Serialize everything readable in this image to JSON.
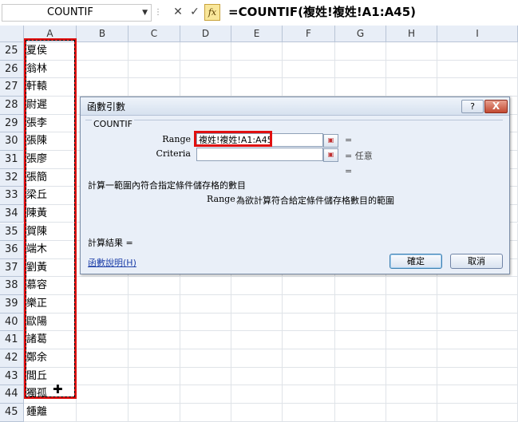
{
  "formula_bar": {
    "name_box": "COUNTIF",
    "formula": "=COUNTIF(複姓!複姓!A1:A45)",
    "fx_label": "fx"
  },
  "grid": {
    "columns": [
      "A",
      "B",
      "C",
      "D",
      "E",
      "F",
      "G",
      "H",
      "I"
    ],
    "rows": [
      {
        "num": "25",
        "a": "夏侯"
      },
      {
        "num": "26",
        "a": "翁林"
      },
      {
        "num": "27",
        "a": "軒轅"
      },
      {
        "num": "28",
        "a": "尉遲"
      },
      {
        "num": "29",
        "a": "張李"
      },
      {
        "num": "30",
        "a": "張陳"
      },
      {
        "num": "31",
        "a": "張廖"
      },
      {
        "num": "32",
        "a": "張簡"
      },
      {
        "num": "33",
        "a": "梁丘"
      },
      {
        "num": "34",
        "a": "陳黃"
      },
      {
        "num": "35",
        "a": "賀陳"
      },
      {
        "num": "36",
        "a": "端木"
      },
      {
        "num": "37",
        "a": "劉黃"
      },
      {
        "num": "38",
        "a": "慕容"
      },
      {
        "num": "39",
        "a": "樂正"
      },
      {
        "num": "40",
        "a": "歐陽"
      },
      {
        "num": "41",
        "a": "諸葛"
      },
      {
        "num": "42",
        "a": "鄭余"
      },
      {
        "num": "43",
        "a": "閭丘"
      },
      {
        "num": "44",
        "a": "獨孤"
      },
      {
        "num": "45",
        "a": "鍾離"
      }
    ]
  },
  "dialog": {
    "title": "函數引數",
    "help_button": "?",
    "close_button": "X",
    "function_name": "COUNTIF",
    "args": [
      {
        "label": "Range",
        "value": "複姓!複姓!A1:A45",
        "result": "="
      },
      {
        "label": "Criteria",
        "value": "",
        "result": "= 任意"
      }
    ],
    "overall_result_eq": "=",
    "description": "計算一範圍內符合指定條件儲存格的數目",
    "arg_desc_name": "Range",
    "arg_desc_text": "為欲計算符合給定條件儲存格數目的範圍",
    "result_label": "計算結果 =",
    "help_link": "函數說明(H)",
    "ok_label": "確定",
    "cancel_label": "取消"
  }
}
